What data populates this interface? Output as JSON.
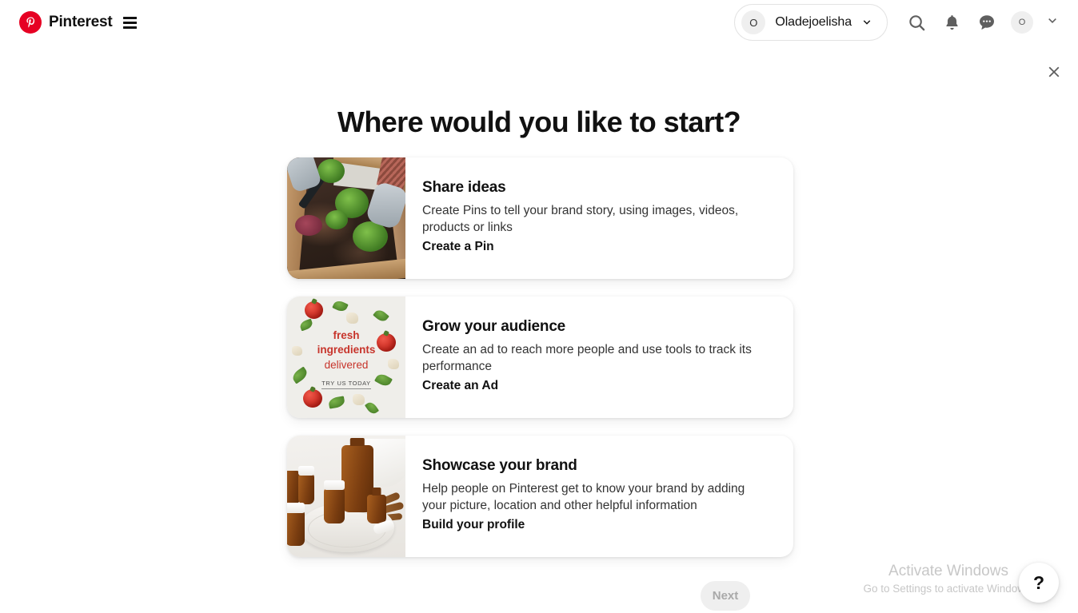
{
  "header": {
    "brand_name": "Pinterest",
    "logo_icon": "pinterest-logo-icon",
    "menu_icon": "hamburger-menu-icon",
    "account": {
      "avatar_initial": "O",
      "name": "Oladejoelisha",
      "chevron_icon": "chevron-down-icon"
    },
    "actions": [
      {
        "icon": "search-icon",
        "label": "Search"
      },
      {
        "icon": "bell-icon",
        "label": "Notifications"
      },
      {
        "icon": "chat-bubble-icon",
        "label": "Messages"
      }
    ],
    "mini_avatar_initial": "O",
    "caret_icon": "chevron-down-icon"
  },
  "close_icon": "close-icon",
  "main": {
    "title": "Where would you like to start?",
    "cards": [
      {
        "id": "share-ideas",
        "title": "Share ideas",
        "description": "Create Pins to tell your brand story, using images, videos, products or links",
        "cta": "Create a Pin",
        "thumb_alt": "garden-bed-lettuce-photo"
      },
      {
        "id": "grow-your-audience",
        "title": "Grow your audience",
        "description": "Create an ad to reach more people and use tools to track its performance",
        "cta": "Create an Ad",
        "thumb_alt": "fresh-ingredients-ad-photo",
        "thumb_text": {
          "line1": "fresh",
          "line2": "ingredients",
          "line3": "delivered",
          "cta": "TRY US TODAY"
        }
      },
      {
        "id": "showcase-your-brand",
        "title": "Showcase your brand",
        "description": "Help people on Pinterest get to know your brand by adding your picture, location and other helpful information",
        "cta": "Build your profile",
        "thumb_alt": "amber-essential-oil-bottles-photo"
      }
    ]
  },
  "footer": {
    "next_label": "Next"
  },
  "watermark": {
    "title": "Activate Windows",
    "subtitle": "Go to Settings to activate Windows."
  },
  "help": {
    "label": "?"
  },
  "colors": {
    "brand_red": "#e60023",
    "ad_red": "#c7342b",
    "text_primary": "#111111",
    "text_secondary": "#333333",
    "next_bg": "#efefef",
    "next_text": "#a9a9a9",
    "watermark_text": "#c7c7c7"
  }
}
